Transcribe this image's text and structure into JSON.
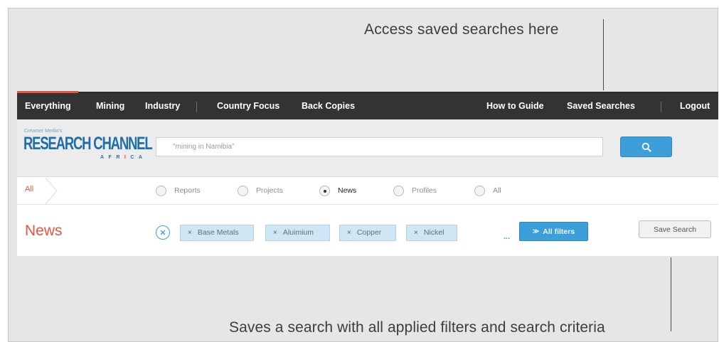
{
  "callouts": {
    "top": "Access saved searches here",
    "bottom": "Saves a search with all applied filters and search criteria"
  },
  "nav": {
    "left": [
      {
        "label": "Everything",
        "active": true
      },
      {
        "label": "Mining"
      },
      {
        "label": "Industry"
      },
      {
        "label": "Country Focus"
      },
      {
        "label": "Back Copies"
      }
    ],
    "right": [
      {
        "label": "How to Guide"
      },
      {
        "label": "Saved Searches"
      },
      {
        "label": "Logout"
      }
    ]
  },
  "logo": {
    "small": "Creamer Media's",
    "main": "RESEARCH CHANNEL",
    "sub_left": "AFR",
    "sub_red": "I",
    "sub_right": "CA"
  },
  "search": {
    "value": "\"mining in Namibia\"",
    "button_icon": "search-icon"
  },
  "filter_row": {
    "crumb": "All",
    "options": [
      {
        "label": "Reports",
        "checked": false
      },
      {
        "label": "Projects",
        "checked": false
      },
      {
        "label": "News",
        "checked": true
      },
      {
        "label": "Profiles",
        "checked": false
      },
      {
        "label": "All",
        "checked": false
      }
    ]
  },
  "news_row": {
    "title": "News",
    "chips": [
      "Base Metals",
      "Aluimium",
      "Copper",
      "Nickel"
    ],
    "chip_remove_glyph": "×",
    "more": "...",
    "all_filters": "All filters",
    "save_search": "Save Search"
  },
  "colors": {
    "accent": "#e4553b",
    "nav_bg": "#333333",
    "button_blue": "#3d9fd9",
    "chip_bg": "#cfe6f5"
  }
}
